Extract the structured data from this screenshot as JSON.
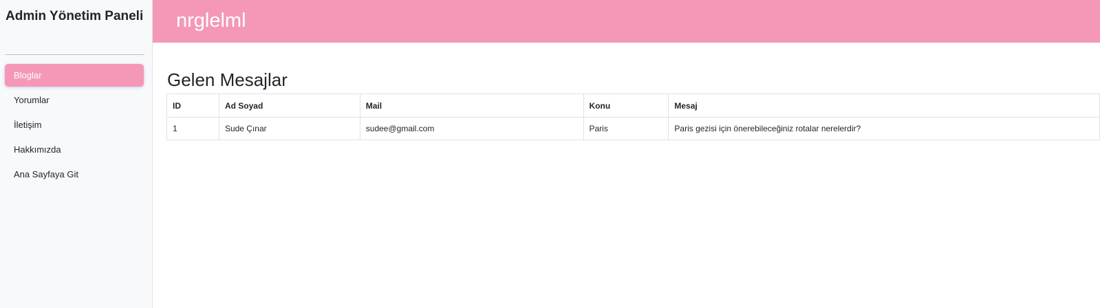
{
  "sidebar": {
    "title": "Admin Yönetim Paneli",
    "items": [
      {
        "label": "Bloglar",
        "active": true
      },
      {
        "label": "Yorumlar",
        "active": false
      },
      {
        "label": "İletişim",
        "active": false
      },
      {
        "label": "Hakkımızda",
        "active": false
      },
      {
        "label": "Ana Sayfaya Git",
        "active": false
      }
    ]
  },
  "header": {
    "title": "nrglelml"
  },
  "main": {
    "title": "Gelen Mesajlar",
    "table": {
      "columns": [
        "ID",
        "Ad Soyad",
        "Mail",
        "Konu",
        "Mesaj"
      ],
      "rows": [
        [
          "1",
          "Sude Çınar",
          "sudee@gmail.com",
          "Paris",
          "Paris gezisi için önerebileceğiniz rotalar nerelerdir?"
        ]
      ]
    }
  },
  "colors": {
    "accent": "#f598b7",
    "sidebar_bg": "#f8f9fa",
    "text": "#212529",
    "border": "#dee2e6"
  }
}
